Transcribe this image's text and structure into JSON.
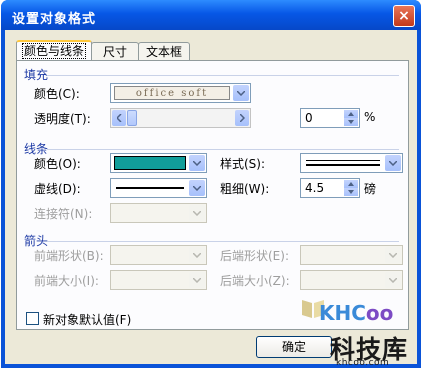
{
  "window": {
    "title": "设置对象格式",
    "close_glyph": "×"
  },
  "tabs": [
    {
      "label": "颜色与线条",
      "active": true
    },
    {
      "label": "尺寸",
      "active": false
    },
    {
      "label": "文本框",
      "active": false
    }
  ],
  "fill": {
    "section_label": "填充",
    "color_label": "颜色(C):",
    "color_pattern_text": "office soft",
    "transparency_label": "透明度(T):",
    "transparency_value": "0",
    "transparency_unit": "%",
    "transparency_level": 0
  },
  "line": {
    "section_label": "线条",
    "color_label": "颜色(O):",
    "color_value": "#119e9a",
    "style_label": "样式(S):",
    "dash_label": "虚线(D):",
    "weight_label": "粗细(W):",
    "weight_value": "4.5",
    "weight_unit": "磅",
    "connector_label": "连接符(N):"
  },
  "arrows": {
    "section_label": "箭头",
    "begin_style_label": "前端形状(B):",
    "end_style_label": "后端形状(E):",
    "begin_size_label": "前端大小(I):",
    "end_size_label": "后端大小(Z):"
  },
  "default_checkbox_label": "新对象默认值(F)",
  "ok_button_label": "确定",
  "watermark": {
    "logo_k": "KHC",
    "logo_rest": "oo",
    "cn": "科技库",
    "url": "khcoo.com"
  },
  "colors": {
    "accent": "#0a53d8",
    "section": "#1d3aa5",
    "line_color": "#119e9a"
  },
  "icons": [
    "close-icon",
    "chevron-down-icon",
    "chevron-left-icon",
    "chevron-right-icon",
    "spin-up-icon",
    "spin-down-icon"
  ]
}
